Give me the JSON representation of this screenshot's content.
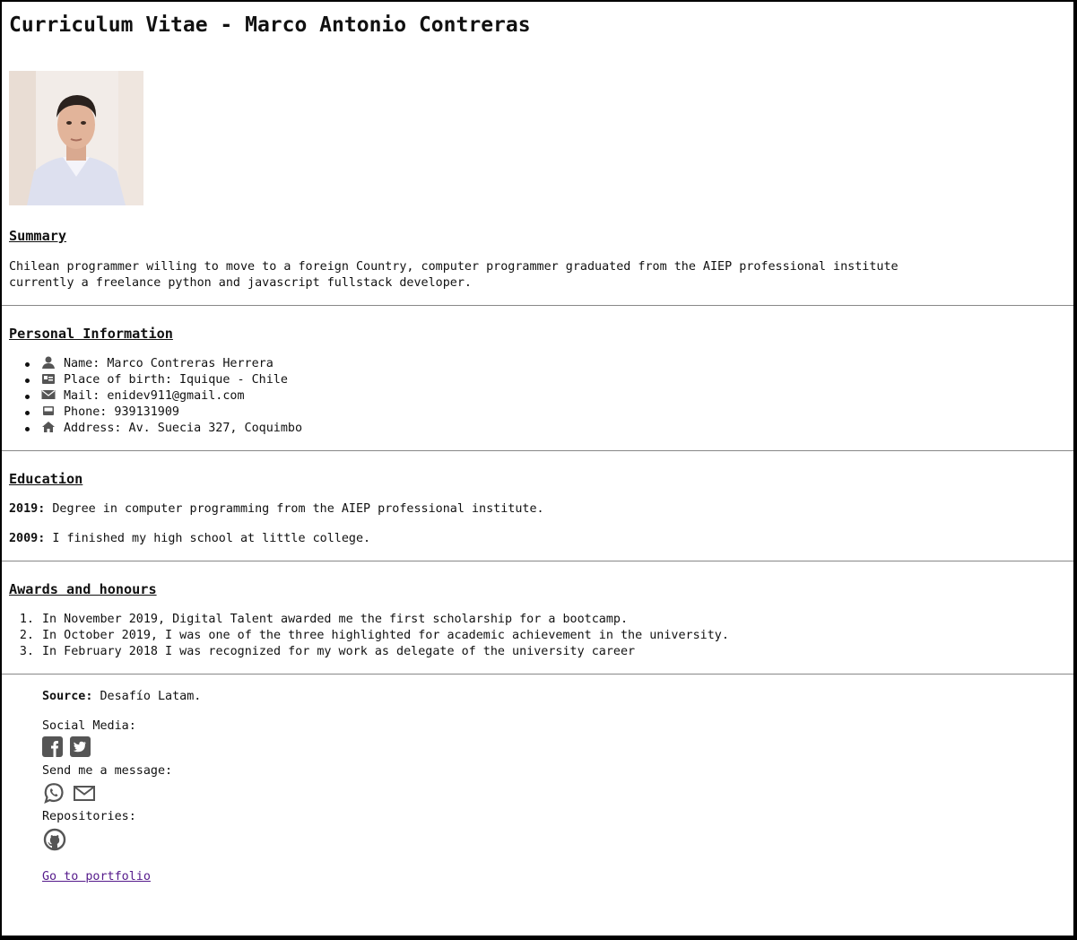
{
  "title": "Curriculum Vitae - Marco Antonio Contreras",
  "summary": {
    "heading": "Summary",
    "line1": "Chilean programmer willing to move to a foreign Country, computer programmer graduated from the AIEP professional institute",
    "line2": "currently a freelance python and javascript fullstack developer."
  },
  "personal": {
    "heading": "Personal Information",
    "items": [
      {
        "icon": "user-icon",
        "text": "Name: Marco Contreras Herrera"
      },
      {
        "icon": "id-card-icon",
        "text": "Place of birth: Iquique - Chile"
      },
      {
        "icon": "envelope-icon",
        "text": "Mail: enidev911@gmail.com"
      },
      {
        "icon": "phone-icon",
        "text": "Phone: 939131909"
      },
      {
        "icon": "home-icon",
        "text": "Address: Av. Suecia 327, Coquimbo"
      }
    ]
  },
  "education": {
    "heading": "Education",
    "entries": [
      {
        "year": "2019:",
        "text": " Degree in computer programming from the AIEP professional institute."
      },
      {
        "year": "2009:",
        "text": " I finished my high school at little college."
      }
    ]
  },
  "awards": {
    "heading": "Awards and honours",
    "items": [
      {
        "num": "1.",
        "text": "In November 2019, Digital Talent awarded me the first scholarship for a bootcamp."
      },
      {
        "num": "2.",
        "text": "In October 2019, I was one of the three highlighted for academic achievement in the university."
      },
      {
        "num": "3.",
        "text": "In February 2018 I was recognized for my work as delegate of the university career"
      }
    ]
  },
  "footer": {
    "source_label": "Source:",
    "source_text": " Desafío Latam.",
    "social_label": "Social Media:",
    "social_icons": [
      "facebook-icon",
      "twitter-icon"
    ],
    "message_label": "Send me a message:",
    "message_icons": [
      "whatsapp-icon",
      "mail-icon"
    ],
    "repos_label": "Repositories:",
    "repos_icons": [
      "github-icon"
    ],
    "portfolio_link": "Go to portfolio"
  },
  "colors": {
    "link": "#551a8b",
    "divider": "#888888",
    "icon": "#555555"
  }
}
